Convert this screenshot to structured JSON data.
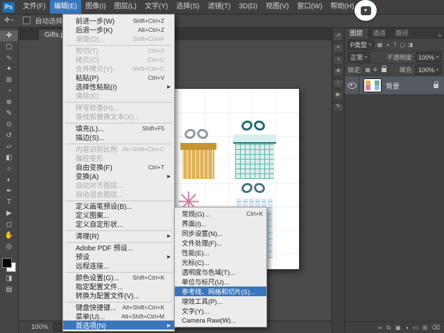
{
  "css_vars": {
    "--accent-blue": "#3a76bc",
    "--menu-bg": "#ececec",
    "--gift1-main": "#e0b052",
    "--gift1-dark": "#c6952f",
    "--gift1-bow": "#8f969c",
    "--gift2-main": "#d8eeea",
    "--gift2-line": "#62b4a8",
    "--gift2-bow": "#1e6a6e",
    "--gift3-main": "#d6799f",
    "--gift4-main": "#dcebf6",
    "--gift4-line": "#90c0df",
    "--gift4-bow": "#46707f",
    "--fg-color": "#000000",
    "--bg-color": "#ffffff"
  },
  "icons": {
    "caret_down": "▾",
    "submenu_arrow": "▶",
    "close": "×",
    "move_tool": "✛",
    "overlay_arrow": "▼",
    "spark": "✳",
    "panel_menu": "≡"
  },
  "menubar": {
    "logo": "Ps",
    "items": [
      {
        "label": "文件(F)"
      },
      {
        "label": "编辑(E)",
        "active": true
      },
      {
        "label": "图像(I)"
      },
      {
        "label": "图层(L)"
      },
      {
        "label": "文字(Y)"
      },
      {
        "label": "选择(S)"
      },
      {
        "label": "滤镜(T)"
      },
      {
        "label": "3D(D)"
      },
      {
        "label": "视图(V)"
      },
      {
        "label": "窗口(W)"
      },
      {
        "label": "帮助(H)"
      }
    ]
  },
  "options_bar": {
    "auto_select_label": "自动选择:"
  },
  "document_tab": {
    "title": "Gifts.png"
  },
  "tools": [
    {
      "name": "move-tool",
      "glyph": "✛",
      "active": true
    },
    {
      "name": "marquee-tool",
      "glyph": "▢"
    },
    {
      "name": "lasso-tool",
      "glyph": "∿"
    },
    {
      "name": "quick-selection-tool",
      "glyph": "✦"
    },
    {
      "name": "crop-tool",
      "glyph": "⊞"
    },
    {
      "name": "eyedropper-tool",
      "glyph": "◔"
    },
    {
      "name": "healing-brush-tool",
      "glyph": "⊕"
    },
    {
      "name": "brush-tool",
      "glyph": "✎"
    },
    {
      "name": "clone-stamp-tool",
      "glyph": "⊙"
    },
    {
      "name": "history-brush-tool",
      "glyph": "↺"
    },
    {
      "name": "eraser-tool",
      "glyph": "▱"
    },
    {
      "name": "gradient-tool",
      "glyph": "◧"
    },
    {
      "name": "blur-tool",
      "glyph": "○"
    },
    {
      "name": "dodge-tool",
      "glyph": "◐"
    },
    {
      "name": "pen-tool",
      "glyph": "✒"
    },
    {
      "name": "type-tool",
      "glyph": "T"
    },
    {
      "name": "path-selection-tool",
      "glyph": "▶"
    },
    {
      "name": "shape-tool",
      "glyph": "◻"
    },
    {
      "name": "hand-tool",
      "glyph": "✋"
    },
    {
      "name": "zoom-tool",
      "glyph": "◎"
    }
  ],
  "toolbar_bottom": [
    {
      "name": "quick-mask-icon",
      "glyph": "◨"
    },
    {
      "name": "screen-mode-icon",
      "glyph": "▤"
    }
  ],
  "edit_menu": {
    "items": [
      {
        "label": "前进一步(W)",
        "shortcut": "Shift+Ctrl+Z"
      },
      {
        "label": "后退一步(K)",
        "shortcut": "Alt+Ctrl+Z"
      },
      {
        "label": "渐隐(D)...",
        "shortcut": "Shift+Ctrl+F",
        "disabled": true
      },
      {
        "is_sep": true
      },
      {
        "label": "剪切(T)",
        "shortcut": "Ctrl+X",
        "disabled": true
      },
      {
        "label": "拷贝(C)",
        "shortcut": "Ctrl+C",
        "disabled": true
      },
      {
        "label": "合并拷贝(Y)",
        "shortcut": "Shift+Ctrl+C",
        "disabled": true
      },
      {
        "label": "粘贴(P)",
        "shortcut": "Ctrl+V"
      },
      {
        "label": "选择性粘贴(I)",
        "submenu": true
      },
      {
        "label": "清除(E)",
        "disabled": true
      },
      {
        "is_sep": true
      },
      {
        "label": "拼写检查(H)...",
        "disabled": true
      },
      {
        "label": "查找和替换文本(X)...",
        "disabled": true
      },
      {
        "is_sep": true
      },
      {
        "label": "填充(L)...",
        "shortcut": "Shift+F5"
      },
      {
        "label": "描边(S)..."
      },
      {
        "is_sep": true
      },
      {
        "label": "内容识别比例",
        "shortcut": "Alt+Shift+Ctrl+C",
        "disabled": true
      },
      {
        "label": "操控变形",
        "disabled": true
      },
      {
        "label": "自由变换(F)",
        "shortcut": "Ctrl+T"
      },
      {
        "label": "变换(A)",
        "submenu": true
      },
      {
        "label": "自动对齐图层...",
        "disabled": true
      },
      {
        "label": "自动混合图层...",
        "disabled": true
      },
      {
        "is_sep": true
      },
      {
        "label": "定义画笔预设(B)..."
      },
      {
        "label": "定义图案..."
      },
      {
        "label": "定义自定形状..."
      },
      {
        "is_sep": true
      },
      {
        "label": "清理(R)",
        "submenu": true
      },
      {
        "is_sep": true
      },
      {
        "label": "Adobe PDF 预设..."
      },
      {
        "label": "预设",
        "submenu": true
      },
      {
        "label": "远程连接..."
      },
      {
        "is_sep": true
      },
      {
        "label": "颜色设置(G)...",
        "shortcut": "Shift+Ctrl+K"
      },
      {
        "label": "指定配置文件..."
      },
      {
        "label": "转换为配置文件(V)..."
      },
      {
        "is_sep": true
      },
      {
        "label": "键盘快捷键...",
        "shortcut": "Alt+Shift+Ctrl+K"
      },
      {
        "label": "菜单(U)...",
        "shortcut": "Alt+Shift+Ctrl+M"
      },
      {
        "label": "首选项(N)",
        "submenu": true,
        "highlighted": true
      }
    ]
  },
  "preferences_submenu": {
    "items": [
      {
        "label": "常规(G)...",
        "shortcut": "Ctrl+K"
      },
      {
        "label": "界面(I)..."
      },
      {
        "label": "同步设置(N)..."
      },
      {
        "label": "文件处理(F)..."
      },
      {
        "label": "性能(E)..."
      },
      {
        "label": "光标(C)..."
      },
      {
        "label": "透明度与色域(T)..."
      },
      {
        "label": "单位与标尺(U)..."
      },
      {
        "label": "参考线、网格和切片(S)...",
        "highlighted": true
      },
      {
        "label": "增效工具(P)..."
      },
      {
        "label": "文字(Y)..."
      },
      {
        "label": "Camera Raw(W)..."
      }
    ]
  },
  "dock_strip": {
    "icons": [
      {
        "name": "history-panel-icon",
        "glyph": "↺"
      },
      {
        "name": "properties-panel-icon",
        "glyph": "≡"
      },
      {
        "name": "adjustments-panel-icon",
        "glyph": "◑"
      },
      {
        "name": "styles-panel-icon",
        "glyph": "❖"
      },
      {
        "name": "info-panel-icon",
        "glyph": "i"
      },
      {
        "name": "actions-panel-icon",
        "glyph": "▶"
      },
      {
        "name": "brush-panel-icon",
        "glyph": "✎"
      }
    ]
  },
  "layers_panel": {
    "tabs": [
      {
        "label": "图层",
        "active": true
      },
      {
        "label": "通道"
      },
      {
        "label": "路径"
      }
    ],
    "filter": {
      "kind_label": "P类型",
      "icons": [
        {
          "name": "filter-pixel-layers-icon",
          "glyph": "▦"
        },
        {
          "name": "filter-adjustment-layers-icon",
          "glyph": "◑"
        },
        {
          "name": "filter-type-layers-icon",
          "glyph": "T"
        },
        {
          "name": "filter-shape-layers-icon",
          "glyph": "▢"
        },
        {
          "name": "filter-smart-objects-icon",
          "glyph": "◨"
        }
      ]
    },
    "blend_mode": "正常",
    "opacity_label": "不透明度:",
    "opacity_value": "100%",
    "lock_label": "锁定:",
    "lock_icons": [
      {
        "name": "lock-transparency-icon",
        "glyph": "▦"
      },
      {
        "name": "lock-position-icon",
        "glyph": "✛"
      }
    ],
    "fill_label": "填充:",
    "fill_value": "100%",
    "layers": [
      {
        "name": "背景",
        "visible": true,
        "locked": true
      }
    ],
    "footer_icons": [
      {
        "name": "link-layers-icon",
        "glyph": "∞"
      },
      {
        "name": "layer-style-icon",
        "glyph": "fx"
      },
      {
        "name": "layer-mask-icon",
        "glyph": "▣"
      },
      {
        "name": "adjustment-layer-icon",
        "glyph": "◑"
      },
      {
        "name": "layer-group-icon",
        "glyph": "▭"
      },
      {
        "name": "new-layer-icon",
        "glyph": "⊞"
      },
      {
        "name": "delete-layer-icon",
        "glyph": "⌫"
      }
    ]
  },
  "status_bar": {
    "zoom": "100%"
  }
}
